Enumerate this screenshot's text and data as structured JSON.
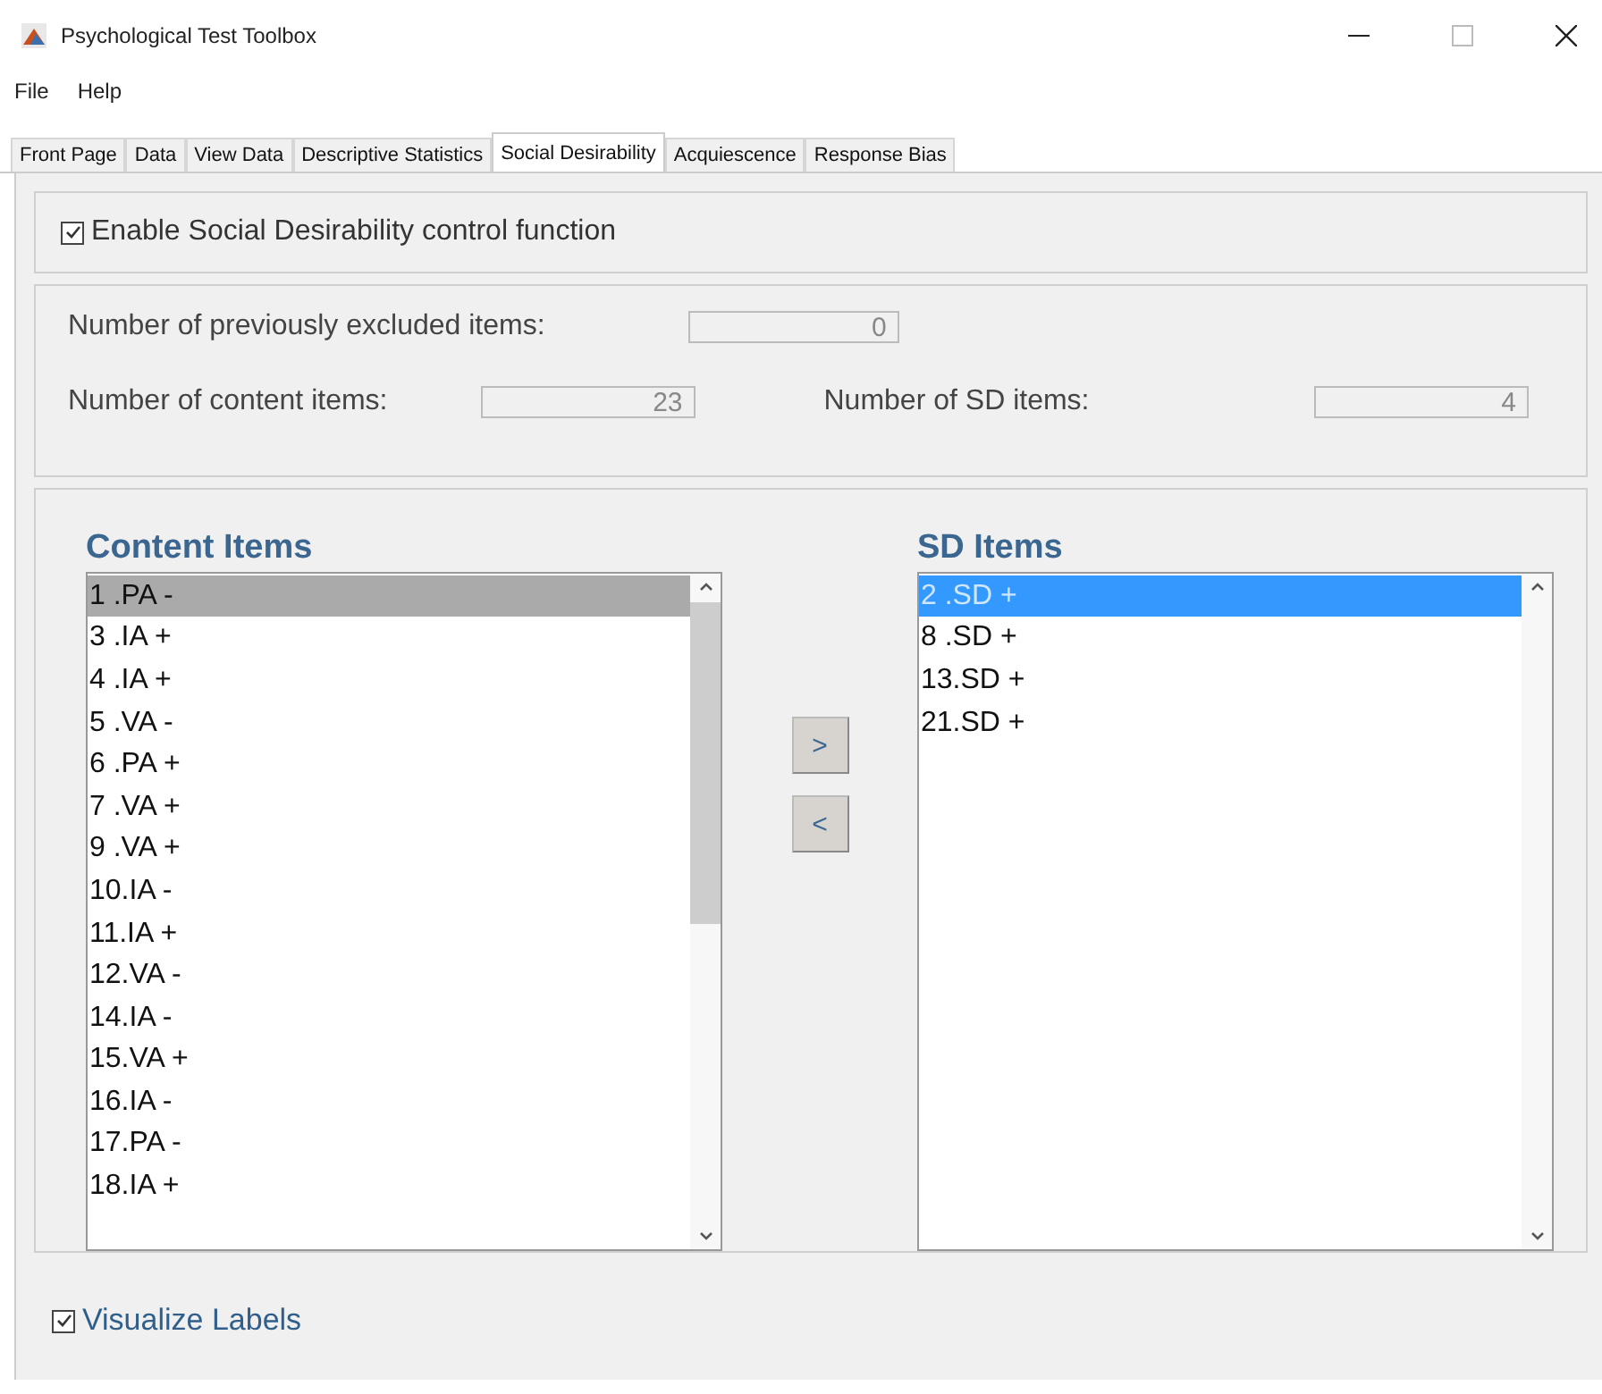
{
  "window": {
    "title": "Psychological Test Toolbox"
  },
  "menu": [
    "File",
    "Help"
  ],
  "tabs": [
    {
      "label": "Front Page",
      "selected": false
    },
    {
      "label": "Data",
      "selected": false
    },
    {
      "label": "View Data",
      "selected": false
    },
    {
      "label": "Descriptive Statistics",
      "selected": false
    },
    {
      "label": "Social Desirability",
      "selected": true
    },
    {
      "label": "Acquiescence",
      "selected": false
    },
    {
      "label": "Response Bias",
      "selected": false
    }
  ],
  "enable_option": {
    "label": "Enable Social Desirability control function",
    "checked": true
  },
  "counts": [
    {
      "label": "Number of previously excluded items:",
      "value": "0"
    },
    {
      "label": "Number of content items:",
      "value": "23"
    },
    {
      "label": "Number of SD items:",
      "value": "4"
    }
  ],
  "content_list": {
    "title": "Content Items",
    "focused": false,
    "items": [
      {
        "label": "1 .PA -",
        "selected": true
      },
      {
        "label": "3 .IA +",
        "selected": false
      },
      {
        "label": "4 .IA +",
        "selected": false
      },
      {
        "label": "5 .VA -",
        "selected": false
      },
      {
        "label": "6 .PA +",
        "selected": false
      },
      {
        "label": "7 .VA +",
        "selected": false
      },
      {
        "label": "9 .VA +",
        "selected": false
      },
      {
        "label": "10.IA -",
        "selected": false
      },
      {
        "label": "11.IA +",
        "selected": false
      },
      {
        "label": "12.VA -",
        "selected": false
      },
      {
        "label": "14.IA -",
        "selected": false
      },
      {
        "label": "15.VA +",
        "selected": false
      },
      {
        "label": "16.IA -",
        "selected": false
      },
      {
        "label": "17.PA -",
        "selected": false
      },
      {
        "label": "18.IA +",
        "selected": false
      }
    ]
  },
  "move_buttons": [
    ">",
    "<"
  ],
  "sd_list": {
    "title": "SD Items",
    "focused": true,
    "items": [
      {
        "label": "2 .SD +",
        "selected": true
      },
      {
        "label": "8 .SD +",
        "selected": false
      },
      {
        "label": "13.SD +",
        "selected": false
      },
      {
        "label": "21.SD +",
        "selected": false
      }
    ]
  },
  "visualize_option": {
    "label": "Visualize Labels",
    "checked": true
  }
}
